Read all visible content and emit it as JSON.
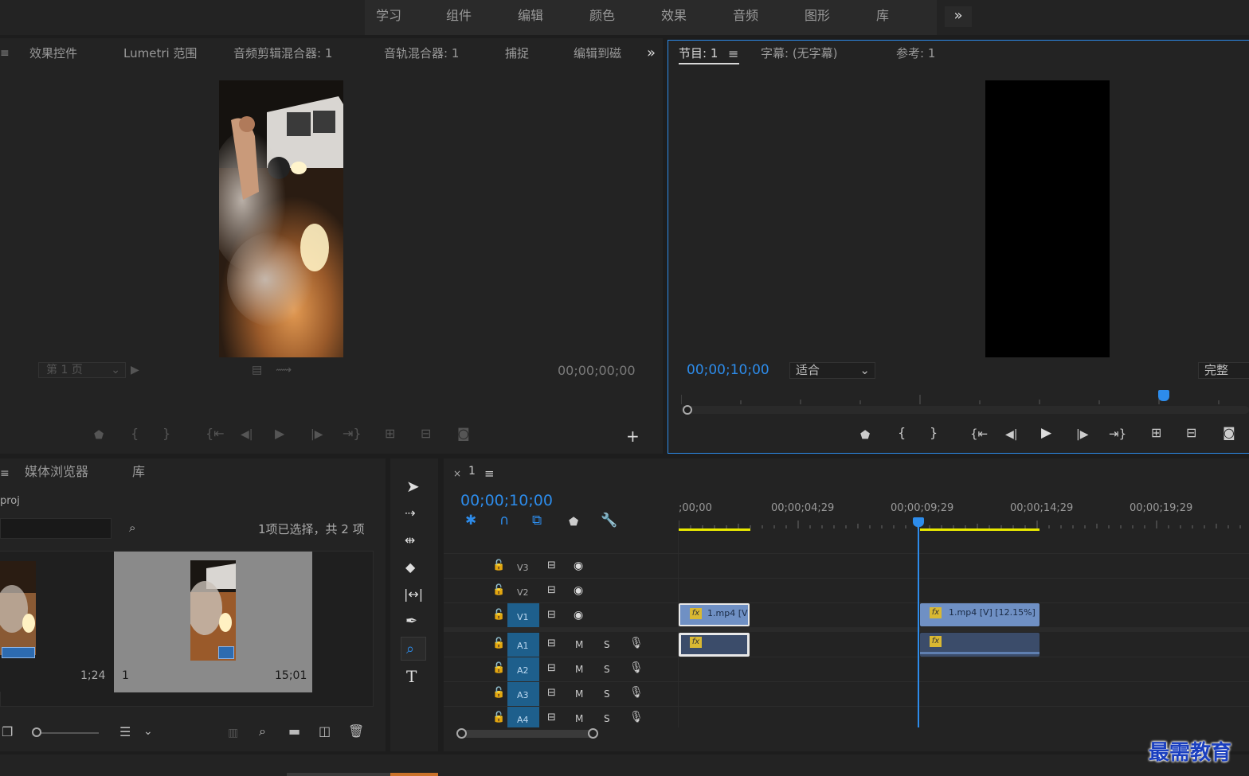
{
  "workspaces": [
    "学习",
    "组件",
    "编辑",
    "颜色",
    "效果",
    "音频",
    "图形",
    "库"
  ],
  "overflow_icon": "double-chevron-right",
  "source_panel": {
    "tabs": [
      "效果控件",
      "Lumetri 范围",
      "音频剪辑混合器: 1",
      "音轨混合器: 1",
      "捕捉",
      "编辑到磁"
    ],
    "page_select": "第 1 页",
    "timecode": "00;00;00;00"
  },
  "program_panel": {
    "tabs": [
      "节目: 1",
      "字幕: (无字幕)",
      "参考: 1"
    ],
    "timecode": "00;00;10;00",
    "fit_select": "适合",
    "quality_select": "完整"
  },
  "project_panel": {
    "tabs": [
      "媒体浏览器",
      "库"
    ],
    "project_name": "proj",
    "selection_status": "1项已选择，共 2 项",
    "items": [
      {
        "name": "",
        "duration": "1;24"
      },
      {
        "name": "1",
        "duration": "15;01"
      }
    ]
  },
  "timeline_panel": {
    "sequence_name": "1",
    "timecode": "00;00;10;00",
    "ruler_labels": [
      ";00;00",
      "00;00;04;29",
      "00;00;09;29",
      "00;00;14;29",
      "00;00;19;29"
    ],
    "video_tracks": [
      {
        "name": "V3"
      },
      {
        "name": "V2"
      },
      {
        "name": "V1"
      }
    ],
    "audio_tracks": [
      {
        "name": "A1",
        "mute": "M",
        "solo": "S"
      },
      {
        "name": "A2",
        "mute": "M",
        "solo": "S"
      },
      {
        "name": "A3",
        "mute": "M",
        "solo": "S"
      },
      {
        "name": "A4",
        "mute": "M",
        "solo": "S"
      }
    ],
    "clips": {
      "v1_clip_a": "1.mp4 [V",
      "v1_clip_b": "1.mp4 [V] [12.15%]",
      "fx_badge": "fx"
    }
  },
  "watermark": "最需教育",
  "colors": {
    "accent_blue": "#2d8ceb",
    "timeline_yellow": "#e8e800",
    "clip_blue": "#6f90c4",
    "track_highlight": "#1e5f8c"
  }
}
